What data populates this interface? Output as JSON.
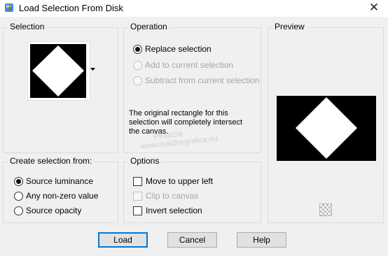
{
  "window": {
    "title": "Load Selection From Disk",
    "close_glyph": "✕"
  },
  "selection": {
    "title": "Selection",
    "dropdown_icon": "triangle-down"
  },
  "operation": {
    "title": "Operation",
    "options": [
      {
        "label": "Replace selection",
        "checked": true,
        "enabled": true
      },
      {
        "label": "Add to current selection",
        "checked": false,
        "enabled": false
      },
      {
        "label": "Subtract from current selection",
        "checked": false,
        "enabled": false
      }
    ],
    "info_lines": [
      "The original rectangle for this",
      "selection will completely intersect",
      "the canvas."
    ]
  },
  "preview": {
    "title": "Preview"
  },
  "create_from": {
    "title": "Create selection from:",
    "options": [
      {
        "label": "Source luminance",
        "checked": true
      },
      {
        "label": "Any non-zero value",
        "checked": false
      },
      {
        "label": "Source opacity",
        "checked": false
      }
    ]
  },
  "options": {
    "title": "Options",
    "items": [
      {
        "label": "Move to upper left",
        "checked": false,
        "enabled": true
      },
      {
        "label": "Clip to canvas",
        "checked": false,
        "enabled": false
      },
      {
        "label": "Invert selection",
        "checked": false,
        "enabled": true
      }
    ]
  },
  "buttons": {
    "load": "Load",
    "cancel": "Cancel",
    "help": "Help"
  },
  "watermark": {
    "line1": "Pinuccia",
    "line2": "www.maidiregrafica.eu"
  }
}
